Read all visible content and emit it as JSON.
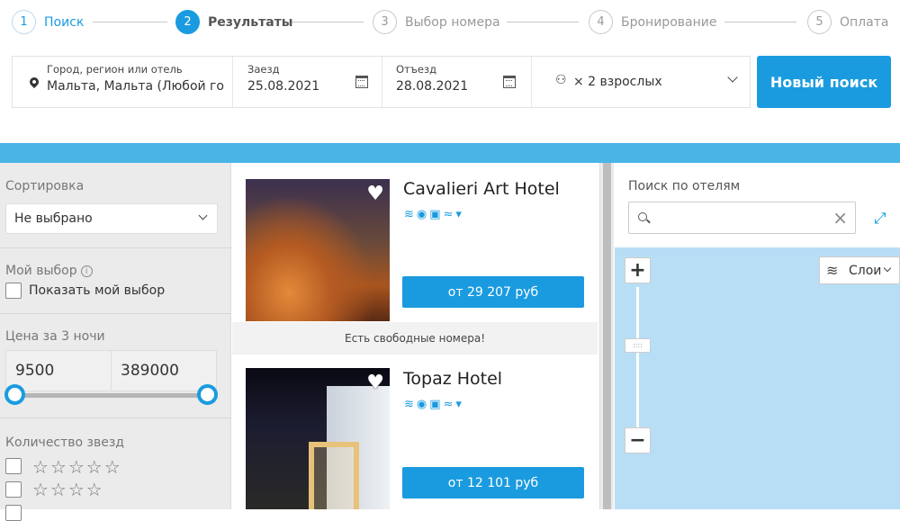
{
  "steps": [
    {
      "num": "1",
      "label": "Поиск"
    },
    {
      "num": "2",
      "label": "Результаты"
    },
    {
      "num": "3",
      "label": "Выбор номера"
    },
    {
      "num": "4",
      "label": "Бронирование"
    },
    {
      "num": "5",
      "label": "Оплата"
    }
  ],
  "search": {
    "destination_caption": "Город, регион или отель",
    "destination_value": "Мальта, Мальта (Любой го",
    "checkin_caption": "Заезд",
    "checkin_value": "25.08.2021",
    "checkout_caption": "Отъезд",
    "checkout_value": "28.08.2021",
    "guests_value": "× 2 взрослых",
    "new_search_label": "Новый поиск"
  },
  "sidebar": {
    "sort_title": "Сортировка",
    "sort_value": "Не выбрано",
    "mychoice_title": "Мой выбор",
    "mychoice_info": "i",
    "mychoice_checkbox": "Показать мой выбор",
    "price_title": "Цена за 3 ночи",
    "price_min": "9500",
    "price_max": "389000",
    "stars_title": "Количество звезд",
    "star_rows": [
      "☆☆☆☆☆",
      "☆☆☆☆"
    ]
  },
  "hotels": [
    {
      "name": "Cavalieri Art Hotel",
      "amenities": "≋◉▣≈▾",
      "price": "от 29 207 руб",
      "availability": "Есть свободные номера!"
    },
    {
      "name": "Topaz Hotel",
      "amenities": "≋◉▣≈▾",
      "price": "от 12 101 руб"
    }
  ],
  "map_panel": {
    "search_title": "Поиск по отелям",
    "search_placeholder": "",
    "clear_icon": "×",
    "expand_icon": "⤢",
    "zoom_in": "+",
    "zoom_out": "−",
    "zoom_handle": "::::",
    "layers_label": "Слои"
  },
  "colors": {
    "accent": "#1a9be0",
    "map_water": "#b8def5",
    "band": "#4ab4e6"
  }
}
